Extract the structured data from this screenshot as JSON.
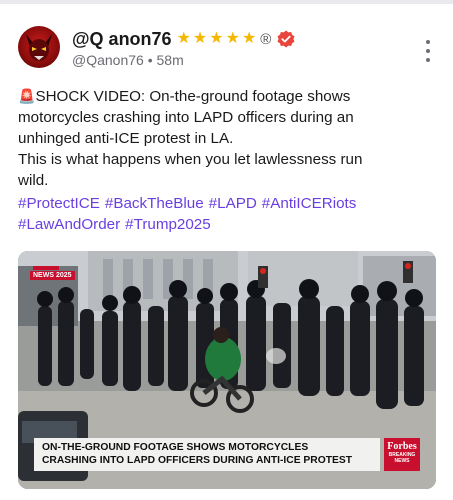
{
  "post": {
    "author": {
      "display_name": "@Q anon76",
      "stars": [
        "★",
        "★",
        "★",
        "★",
        "★"
      ],
      "registered_mark": "®",
      "handle": "@Qanon76",
      "separator": "•",
      "time_ago": "58m"
    },
    "menu_icon": "more-vertical-icon",
    "body": {
      "siren_icon": "🚨",
      "lines": [
        "SHOCK VIDEO: On-the-ground footage shows",
        "motorcycles crashing into LAPD officers during an",
        "unhinged anti-ICE protest in LA.",
        "This is what happens when you let lawlessness run",
        "wild."
      ]
    },
    "hashtags": {
      "line1": [
        "#ProtectICE",
        "#BackTheBlue",
        "#LAPD",
        "#AntiICERiots"
      ],
      "line2": [
        "#LawAndOrder",
        "#Trump2025"
      ]
    },
    "media": {
      "corner_tag": "NEWS 2025",
      "caption_line1": "ON-THE-GROUND FOOTAGE SHOWS MOTORCYCLES",
      "caption_line2": "CRASHING INTO LAPD OFFICERS DURING ANTI-ICE PROTEST",
      "brand": "Forbes",
      "brand_sub1": "BREAKING",
      "brand_sub2": "NEWS"
    },
    "colors": {
      "hashtag": "#6a3fe0",
      "star": "#f5b800",
      "verified": "#e8453c",
      "brand": "#c8102e"
    }
  }
}
